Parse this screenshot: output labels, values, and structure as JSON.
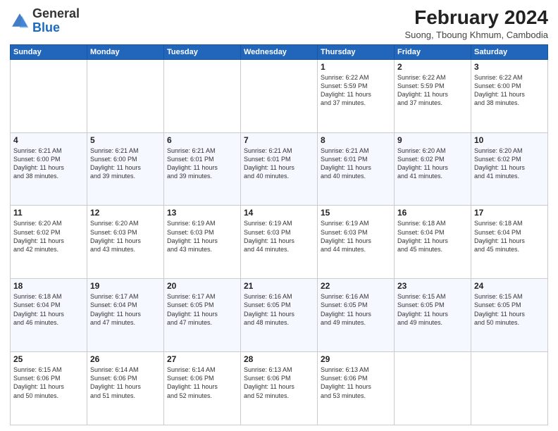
{
  "header": {
    "logo": {
      "general": "General",
      "blue": "Blue"
    },
    "title": "February 2024",
    "location": "Suong, Tboung Khmum, Cambodia"
  },
  "days_of_week": [
    "Sunday",
    "Monday",
    "Tuesday",
    "Wednesday",
    "Thursday",
    "Friday",
    "Saturday"
  ],
  "weeks": [
    [
      {
        "day": "",
        "info": ""
      },
      {
        "day": "",
        "info": ""
      },
      {
        "day": "",
        "info": ""
      },
      {
        "day": "",
        "info": ""
      },
      {
        "day": "1",
        "info": "Sunrise: 6:22 AM\nSunset: 5:59 PM\nDaylight: 11 hours\nand 37 minutes."
      },
      {
        "day": "2",
        "info": "Sunrise: 6:22 AM\nSunset: 5:59 PM\nDaylight: 11 hours\nand 37 minutes."
      },
      {
        "day": "3",
        "info": "Sunrise: 6:22 AM\nSunset: 6:00 PM\nDaylight: 11 hours\nand 38 minutes."
      }
    ],
    [
      {
        "day": "4",
        "info": "Sunrise: 6:21 AM\nSunset: 6:00 PM\nDaylight: 11 hours\nand 38 minutes."
      },
      {
        "day": "5",
        "info": "Sunrise: 6:21 AM\nSunset: 6:00 PM\nDaylight: 11 hours\nand 39 minutes."
      },
      {
        "day": "6",
        "info": "Sunrise: 6:21 AM\nSunset: 6:01 PM\nDaylight: 11 hours\nand 39 minutes."
      },
      {
        "day": "7",
        "info": "Sunrise: 6:21 AM\nSunset: 6:01 PM\nDaylight: 11 hours\nand 40 minutes."
      },
      {
        "day": "8",
        "info": "Sunrise: 6:21 AM\nSunset: 6:01 PM\nDaylight: 11 hours\nand 40 minutes."
      },
      {
        "day": "9",
        "info": "Sunrise: 6:20 AM\nSunset: 6:02 PM\nDaylight: 11 hours\nand 41 minutes."
      },
      {
        "day": "10",
        "info": "Sunrise: 6:20 AM\nSunset: 6:02 PM\nDaylight: 11 hours\nand 41 minutes."
      }
    ],
    [
      {
        "day": "11",
        "info": "Sunrise: 6:20 AM\nSunset: 6:02 PM\nDaylight: 11 hours\nand 42 minutes."
      },
      {
        "day": "12",
        "info": "Sunrise: 6:20 AM\nSunset: 6:03 PM\nDaylight: 11 hours\nand 43 minutes."
      },
      {
        "day": "13",
        "info": "Sunrise: 6:19 AM\nSunset: 6:03 PM\nDaylight: 11 hours\nand 43 minutes."
      },
      {
        "day": "14",
        "info": "Sunrise: 6:19 AM\nSunset: 6:03 PM\nDaylight: 11 hours\nand 44 minutes."
      },
      {
        "day": "15",
        "info": "Sunrise: 6:19 AM\nSunset: 6:03 PM\nDaylight: 11 hours\nand 44 minutes."
      },
      {
        "day": "16",
        "info": "Sunrise: 6:18 AM\nSunset: 6:04 PM\nDaylight: 11 hours\nand 45 minutes."
      },
      {
        "day": "17",
        "info": "Sunrise: 6:18 AM\nSunset: 6:04 PM\nDaylight: 11 hours\nand 45 minutes."
      }
    ],
    [
      {
        "day": "18",
        "info": "Sunrise: 6:18 AM\nSunset: 6:04 PM\nDaylight: 11 hours\nand 46 minutes."
      },
      {
        "day": "19",
        "info": "Sunrise: 6:17 AM\nSunset: 6:04 PM\nDaylight: 11 hours\nand 47 minutes."
      },
      {
        "day": "20",
        "info": "Sunrise: 6:17 AM\nSunset: 6:05 PM\nDaylight: 11 hours\nand 47 minutes."
      },
      {
        "day": "21",
        "info": "Sunrise: 6:16 AM\nSunset: 6:05 PM\nDaylight: 11 hours\nand 48 minutes."
      },
      {
        "day": "22",
        "info": "Sunrise: 6:16 AM\nSunset: 6:05 PM\nDaylight: 11 hours\nand 49 minutes."
      },
      {
        "day": "23",
        "info": "Sunrise: 6:15 AM\nSunset: 6:05 PM\nDaylight: 11 hours\nand 49 minutes."
      },
      {
        "day": "24",
        "info": "Sunrise: 6:15 AM\nSunset: 6:05 PM\nDaylight: 11 hours\nand 50 minutes."
      }
    ],
    [
      {
        "day": "25",
        "info": "Sunrise: 6:15 AM\nSunset: 6:06 PM\nDaylight: 11 hours\nand 50 minutes."
      },
      {
        "day": "26",
        "info": "Sunrise: 6:14 AM\nSunset: 6:06 PM\nDaylight: 11 hours\nand 51 minutes."
      },
      {
        "day": "27",
        "info": "Sunrise: 6:14 AM\nSunset: 6:06 PM\nDaylight: 11 hours\nand 52 minutes."
      },
      {
        "day": "28",
        "info": "Sunrise: 6:13 AM\nSunset: 6:06 PM\nDaylight: 11 hours\nand 52 minutes."
      },
      {
        "day": "29",
        "info": "Sunrise: 6:13 AM\nSunset: 6:06 PM\nDaylight: 11 hours\nand 53 minutes."
      },
      {
        "day": "",
        "info": ""
      },
      {
        "day": "",
        "info": ""
      }
    ]
  ]
}
